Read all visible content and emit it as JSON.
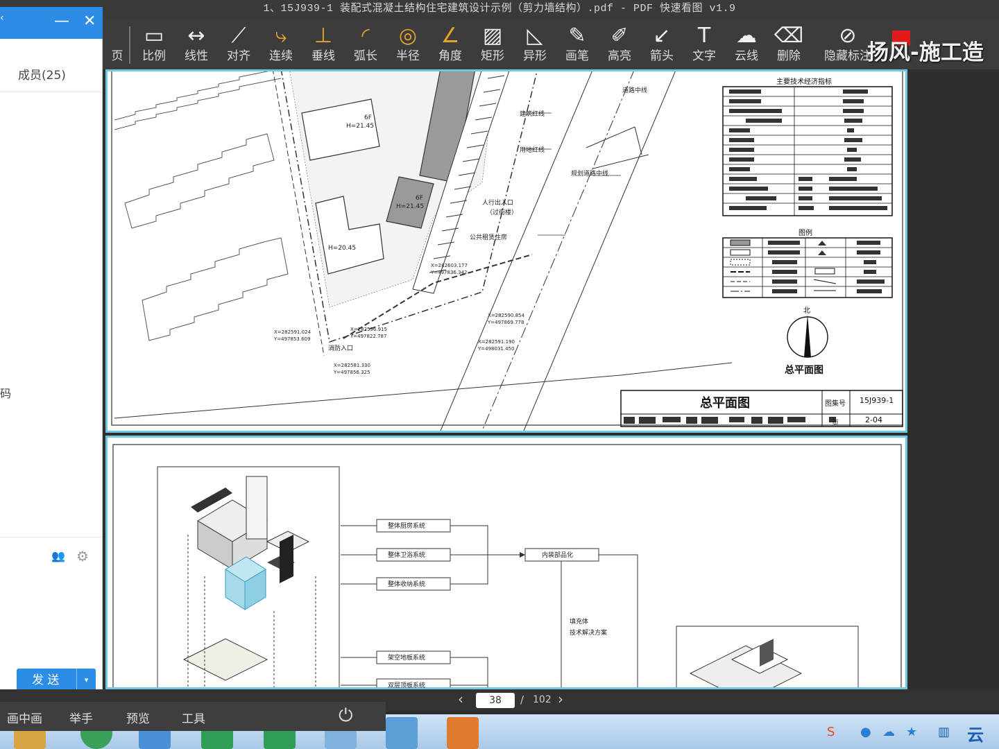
{
  "viewer": {
    "title": "1、15J939-1 装配式混凝土结构住宅建筑设计示例（剪力墙结构）.pdf - PDF 快速看图 v1.9",
    "tools": [
      {
        "label": "页",
        "icon": "home-icon"
      },
      {
        "label": "比例",
        "icon": "scale-ruler-icon"
      },
      {
        "label": "线性",
        "icon": "linear-measure-icon"
      },
      {
        "label": "对齐",
        "icon": "align-measure-icon"
      },
      {
        "label": "连续",
        "icon": "continuous-measure-icon"
      },
      {
        "label": "垂线",
        "icon": "perpendicular-icon"
      },
      {
        "label": "弧长",
        "icon": "arc-length-icon"
      },
      {
        "label": "半径",
        "icon": "radius-icon"
      },
      {
        "label": "角度",
        "icon": "angle-icon"
      },
      {
        "label": "矩形",
        "icon": "rectangle-area-icon"
      },
      {
        "label": "异形",
        "icon": "polygon-area-icon"
      },
      {
        "label": "画笔",
        "icon": "pen-icon"
      },
      {
        "label": "高亮",
        "icon": "highlighter-icon"
      },
      {
        "label": "箭头",
        "icon": "arrow-icon"
      },
      {
        "label": "文字",
        "icon": "text-icon"
      },
      {
        "label": "云线",
        "icon": "cloud-line-icon"
      },
      {
        "label": "删除",
        "icon": "eraser-icon"
      },
      {
        "label": "隐藏标注",
        "icon": "hide-annotation-icon"
      }
    ],
    "watermark": "扬风-施工造",
    "pager": {
      "current": "38",
      "separator": "/",
      "total": "102"
    }
  },
  "drawing_page1": {
    "table_title": "主要技术经济指标",
    "legend_title": "图例",
    "north": "北",
    "plan_title": "总平面图",
    "title_block_title": "总平面图",
    "drawing_no_label": "图集号",
    "drawing_no": "15J939-1",
    "page_label": "页",
    "page_no": "2-04",
    "labels": {
      "road_center": "道路中线",
      "building_line": "建筑红线",
      "property_line": "用地红线",
      "planned_road": "规划道路中线",
      "pedestrian": "人行出入口",
      "walkway": "（过街楼）",
      "fire_entry": "消防入口",
      "rental": "公共租赁住房",
      "b1": "6F",
      "b2": "6F",
      "h1": "H=21.45",
      "h2": "H=21.45",
      "h3": "H=20.45",
      "c1a": "X=282591.024",
      "c1b": "Y=497853.609",
      "c2a": "X=282596.915",
      "c2b": "Y=497822.787",
      "c3a": "X=282590.854",
      "c3b": "Y=497869.778",
      "c4a": "X=282591.190",
      "c4b": "Y=498031.450",
      "c5a": "X=282581.330",
      "c5b": "Y=497856.325",
      "c6a": "X=282603.177",
      "c6b": "Y=497836.342"
    }
  },
  "drawing_page2": {
    "boxes": [
      "整体厨房系统",
      "整体卫浴系统",
      "整体收纳系统",
      "架空地板系统",
      "双层顶板系统"
    ],
    "center_box": "内装部品化",
    "note_1": "填充体",
    "note_2": "技术解决方案"
  },
  "chat": {
    "members": "成员(25)",
    "fragment": "码",
    "send": "发 送",
    "dropdown": "▾"
  },
  "meeting_bar": {
    "items": [
      "画中画",
      "举手",
      "预览",
      "工具"
    ]
  },
  "taskbar": {
    "cloud": "云启"
  },
  "colors": {
    "accent": "#2c8ce6",
    "page_border": "#6fc7e0",
    "gold_icons": "#e2a52a"
  }
}
